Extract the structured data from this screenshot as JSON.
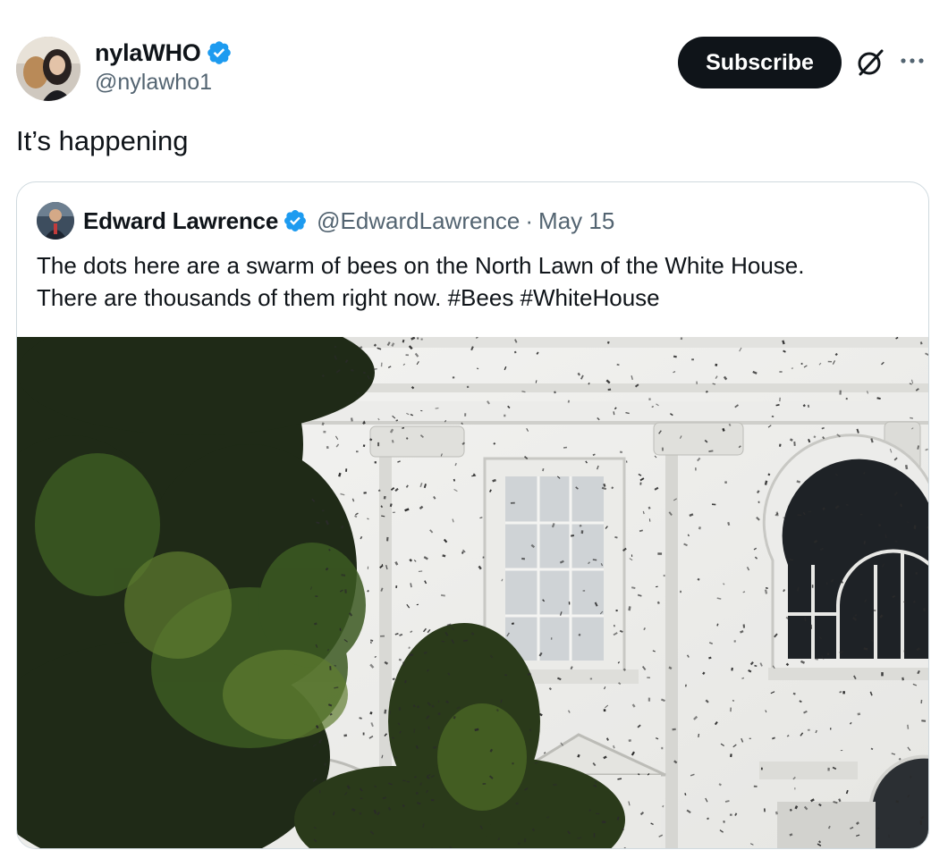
{
  "post": {
    "author": {
      "display_name": "nylaWHO",
      "handle": "@nylawho1",
      "verified": true
    },
    "subscribe_label": "Subscribe",
    "text": "It’s happening"
  },
  "quote": {
    "author": {
      "display_name": "Edward Lawrence",
      "handle": "@EdwardLawrence",
      "verified": true
    },
    "separator": "·",
    "date": "May 15",
    "text_line1": "The dots here are a swarm of bees on the North Lawn of the White House.",
    "text_line2": "There are thousands of them right now. #Bees #WhiteHouse"
  },
  "colors": {
    "verified_blue": "#1d9bf0",
    "text_primary": "#0f1419",
    "text_secondary": "#536471",
    "button_dark": "#0f1419",
    "border": "#cfd9de"
  },
  "icons": [
    "verified-badge-icon",
    "grok-icon",
    "more-icon"
  ]
}
